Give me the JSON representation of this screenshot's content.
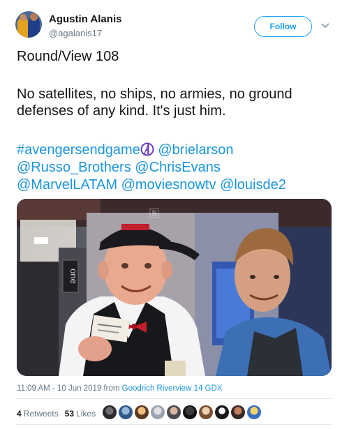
{
  "author": {
    "name": "Agustin Alanis",
    "handle": "@agalanis17"
  },
  "follow_label": "Follow",
  "tweet": {
    "line1": "Round/View 108",
    "line2": "No satellites, no ships, no armies, no ground defenses of any kind. It's just him.",
    "tags": {
      "t1": "#avengersendgame",
      "t2": "@brielarson",
      "t3": "@Russo_Brothers",
      "t4": "@ChrisEvans",
      "t5": "@MarvelLATAM",
      "t6": "@moviesnowtv",
      "t7": "@louisde2"
    }
  },
  "photo": {
    "door_sign": "one"
  },
  "meta": {
    "time": "11:09 AM - 10 Jun 2019",
    "from": "from",
    "location": "Goodrich Riverview 14 GDX"
  },
  "stats": {
    "retweets_count": "4",
    "retweets_label": "Retweets",
    "likes_count": "53",
    "likes_label": "Likes"
  },
  "colors": {
    "link": "#1b95e0",
    "follow_border": "#1da1f2",
    "secondary_text": "#657786"
  }
}
